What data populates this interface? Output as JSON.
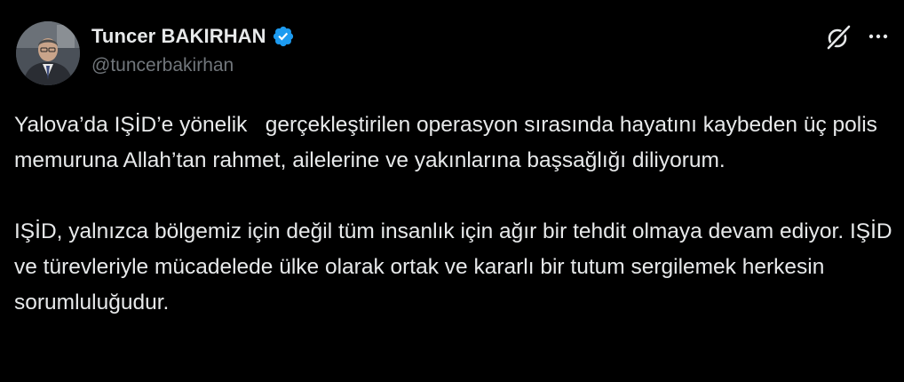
{
  "author": {
    "display_name": "Tuncer BAKIRHAN",
    "handle": "@tuncerbakirhan",
    "verified": true,
    "verified_color": "#1d9bf0"
  },
  "actions": {
    "grok_icon": "grok-icon",
    "more_icon": "more-dots-icon"
  },
  "tweet": {
    "paragraphs": [
      "Yalova’da IŞİD’e yönelik   gerçekleştirilen operasyon sırasında hayatını kaybeden üç polis memuruna Allah’tan rahmet, ailelerine ve yakınlarına başsağlığı diliyorum.",
      "IŞİD, yalnızca bölgemiz için değil tüm insanlık için ağır bir tehdit olmaya devam ediyor. IŞİD ve türevleriyle mücadelede ülke olarak ortak ve kararlı bir tutum sergilemek herkesin sorumluluğudur."
    ]
  },
  "colors": {
    "background": "#000000",
    "text": "#e7e9ea",
    "secondary_text": "#71767b"
  }
}
